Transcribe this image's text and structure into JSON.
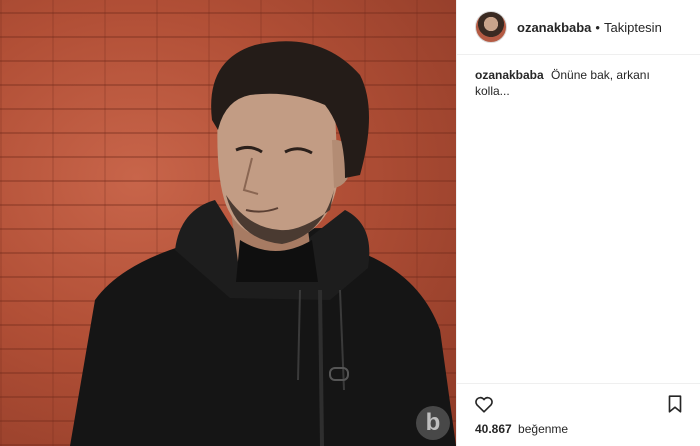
{
  "post": {
    "username": "ozanakbaba",
    "separator": "•",
    "follow_status": "Takiptesin",
    "caption_user": "ozanakbaba",
    "caption_text": "Önüne bak, arkanı kolla...",
    "likes_count": "40.867",
    "likes_label": "beğenme",
    "watermark": "b"
  },
  "icons": {
    "like": "heart-outline-icon",
    "save": "bookmark-outline-icon",
    "avatar": "profile-avatar"
  },
  "colors": {
    "text": "#262626",
    "border": "#efefef",
    "brick": "#b14f36"
  }
}
